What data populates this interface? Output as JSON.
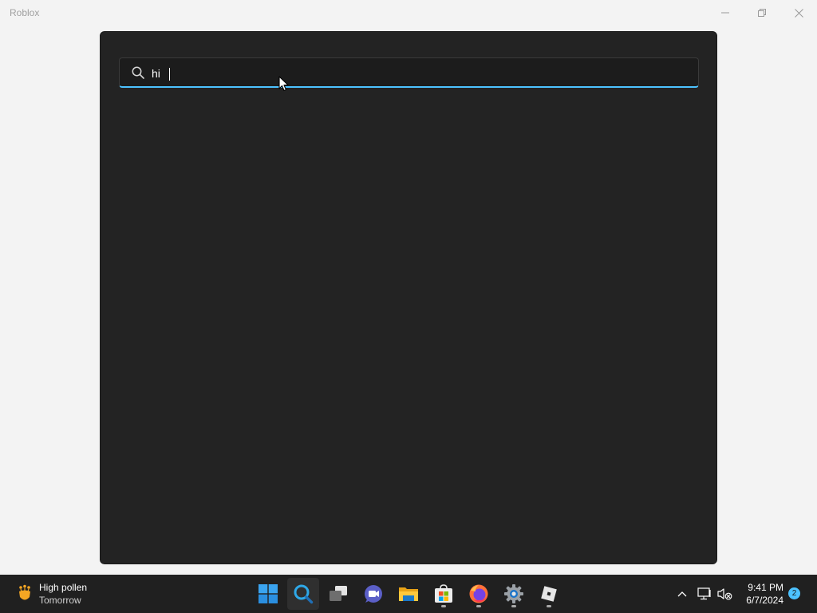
{
  "window": {
    "title": "Roblox"
  },
  "search": {
    "value": "hi",
    "placeholder": ""
  },
  "taskbar": {
    "weather": {
      "title": "High pollen",
      "subtitle": "Tomorrow"
    },
    "pinned": [
      {
        "name": "start",
        "icon": "windows-logo-icon"
      },
      {
        "name": "search",
        "icon": "search-icon",
        "active": true
      },
      {
        "name": "task-view",
        "icon": "task-view-icon"
      },
      {
        "name": "teams",
        "icon": "chat-camera-icon"
      },
      {
        "name": "file-explorer",
        "icon": "folder-icon"
      },
      {
        "name": "microsoft-store",
        "icon": "store-icon"
      },
      {
        "name": "firefox",
        "icon": "firefox-icon"
      },
      {
        "name": "settings",
        "icon": "gear-icon"
      },
      {
        "name": "roblox",
        "icon": "roblox-icon"
      }
    ],
    "clock": {
      "time": "9:41 PM",
      "date": "6/7/2024"
    },
    "notification_count": "2"
  },
  "colors": {
    "accent": "#4cc2ff",
    "panel": "#232323",
    "taskbar": "#202020",
    "background": "#f3f3f3"
  }
}
